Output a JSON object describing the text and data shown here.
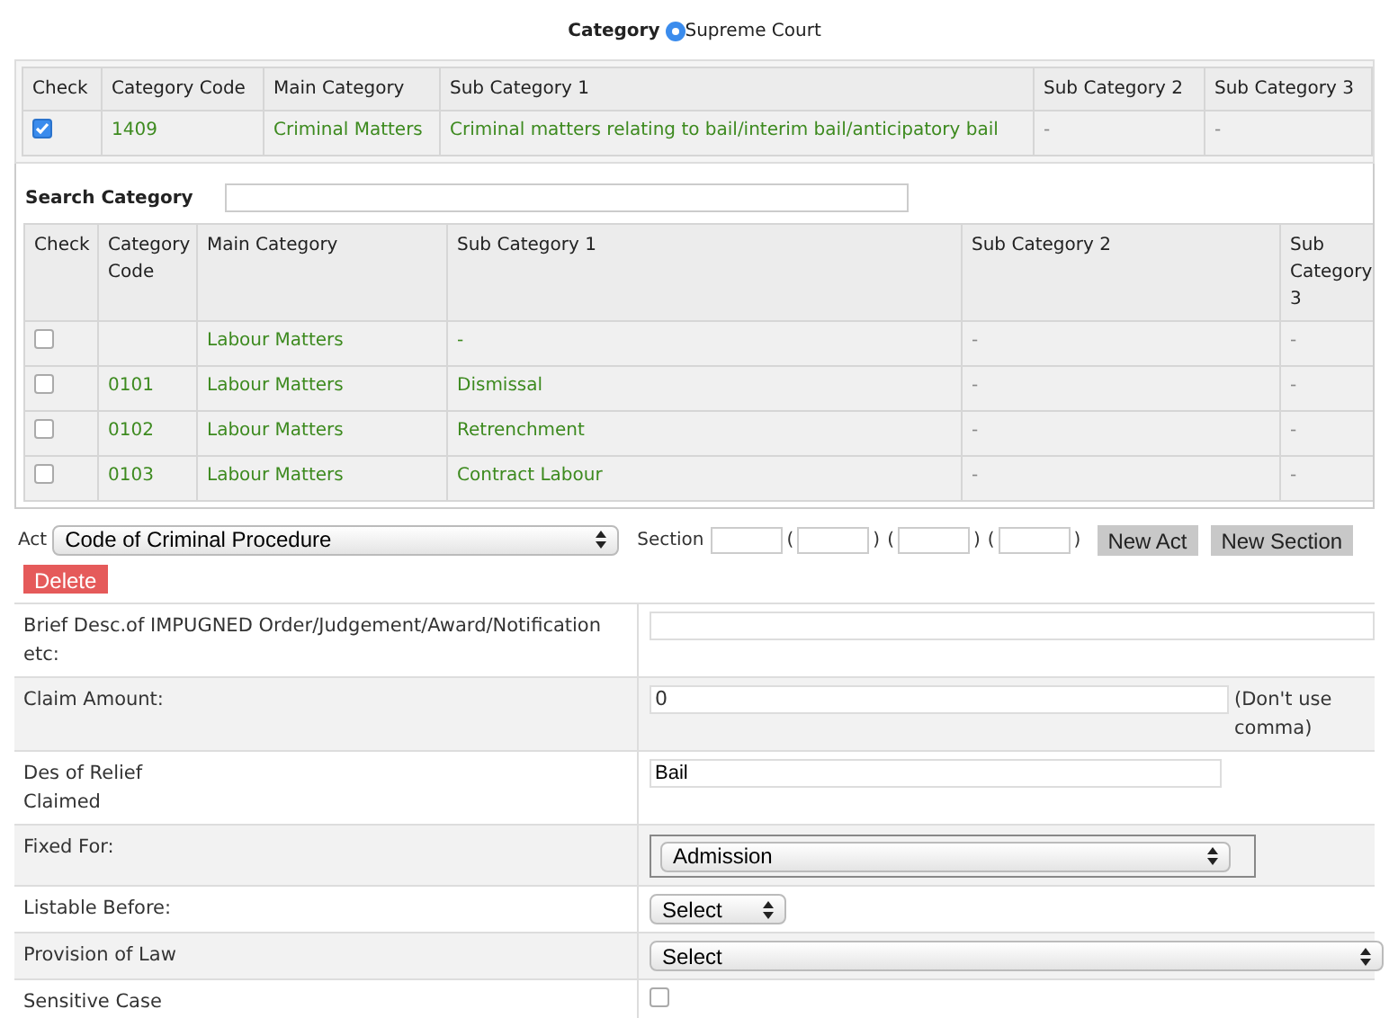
{
  "heading": {
    "label": "Category",
    "court": "Supreme Court"
  },
  "selected_table": {
    "check_column": "Check",
    "columns": [
      "Category Code",
      "Main Category",
      "Sub Category 1",
      "Sub Category 2",
      "Sub Category 3"
    ],
    "rows": [
      {
        "checked": true,
        "cells": [
          "1409",
          "Criminal Matters",
          "Criminal matters relating to bail/interim bail/anticipatory bail",
          "-",
          "-"
        ]
      }
    ]
  },
  "search": {
    "label": "Search Category"
  },
  "category_table": {
    "check_column": "Check",
    "columns": [
      "Category Code",
      "Main Category",
      "Sub Category 1",
      "Sub Category 2",
      "Sub Category 3"
    ],
    "rows": [
      {
        "checked": false,
        "cells": [
          "",
          "Labour Matters",
          "-",
          "-",
          "-"
        ]
      },
      {
        "checked": false,
        "cells": [
          "0101",
          "Labour Matters",
          "Dismissal",
          "-",
          "-"
        ]
      },
      {
        "checked": false,
        "cells": [
          "0102",
          "Labour Matters",
          "Retrenchment",
          "-",
          "-"
        ]
      },
      {
        "checked": false,
        "cells": [
          "0103",
          "Labour Matters",
          "Contract Labour",
          "-",
          "-"
        ]
      }
    ]
  },
  "act": {
    "label": "Act",
    "value": "Code of Criminal Procedure",
    "section_label": "Section",
    "paren_open": "(",
    "paren_close": ")",
    "buttons": [
      "New Act",
      "New Section"
    ],
    "delete": "Delete"
  },
  "form": [
    {
      "kind": "text",
      "label": "Brief Desc.of IMPUGNED Order/Judgement/Award/Notification etc:"
    },
    {
      "kind": "amount",
      "label": "Claim Amount:",
      "value": "0",
      "note": "(Don't use comma)"
    },
    {
      "kind": "short-text",
      "label": "Des of Relief Claimed",
      "value": "Bail"
    },
    {
      "kind": "boxed-select",
      "label": "Fixed For:",
      "value": "Admission"
    },
    {
      "kind": "small-select",
      "label": "Listable Before:",
      "value": "Select"
    },
    {
      "kind": "wide-select",
      "label": "Provision of Law",
      "value": "Select"
    },
    {
      "kind": "checkbox",
      "label": "Sensitive Case",
      "checked": false
    }
  ]
}
